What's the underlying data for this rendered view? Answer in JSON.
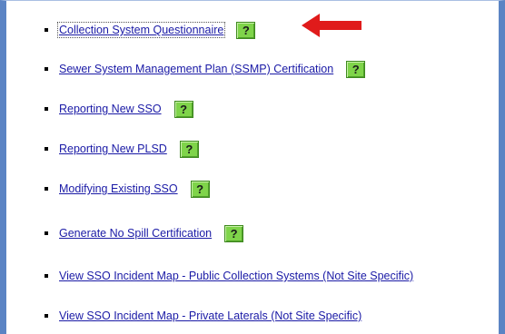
{
  "help_button_label": "?",
  "colors": {
    "frame_border": "#5b84c4",
    "link": "#1a1aa6",
    "help_button": "#7fd44a",
    "arrow": "#e01b1b"
  },
  "menu": {
    "items": [
      {
        "label": "Collection System Questionnaire",
        "has_help": true
      },
      {
        "label": "Sewer System Management Plan (SSMP) Certification",
        "has_help": true
      },
      {
        "label": "Reporting New SSO",
        "has_help": true
      },
      {
        "label": "Reporting New PLSD",
        "has_help": true
      },
      {
        "label": "Modifying Existing SSO",
        "has_help": true
      },
      {
        "label": "Generate No Spill Certification",
        "has_help": true
      },
      {
        "label": "View SSO Incident Map - Public Collection Systems (Not Site Specific)",
        "has_help": false
      },
      {
        "label": "View SSO Incident Map - Private Laterals (Not Site Specific)",
        "has_help": false
      }
    ]
  },
  "annotation": {
    "icon": "red-arrow-icon"
  }
}
